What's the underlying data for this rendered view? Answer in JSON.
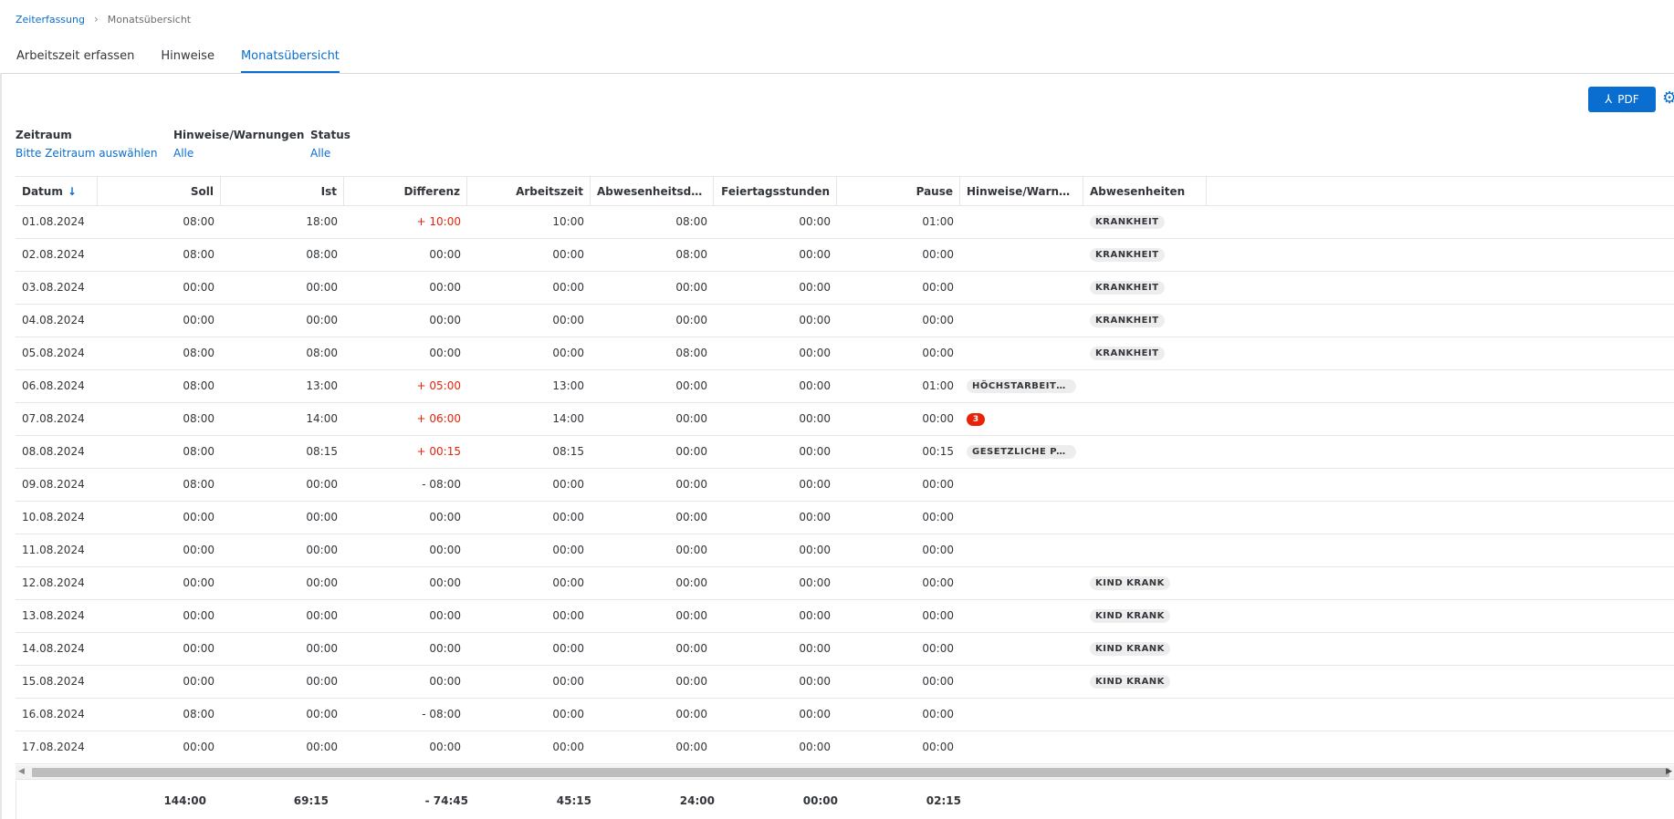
{
  "breadcrumb": {
    "link": "Zeiterfassung",
    "separator": "›",
    "current": "Monatsübersicht"
  },
  "tabs": [
    {
      "label": "Arbeitszeit erfassen"
    },
    {
      "label": "Hinweise"
    },
    {
      "label": "Monatsübersicht"
    }
  ],
  "toolbar": {
    "pdf_label": "PDF",
    "pdf_icon": "acrobat-icon",
    "settings_icon": "gear-icon"
  },
  "filters": {
    "zeitraum": {
      "label": "Zeitraum",
      "value": "Bitte Zeitraum auswählen"
    },
    "hinweise": {
      "label": "Hinweise/Warnungen",
      "value": "Alle"
    },
    "status": {
      "label": "Status",
      "value": "Alle"
    }
  },
  "table": {
    "sort_icon": "sort-descending-icon",
    "columns": [
      "Datum",
      "Soll",
      "Ist",
      "Differenz",
      "Arbeitszeit",
      "Abwesenheitsdauer",
      "Feiertagsstunden",
      "Pause",
      "Hinweise/Warnungen",
      "Abwesenheiten"
    ],
    "rows": [
      {
        "datum": "01.08.2024",
        "soll": "08:00",
        "ist": "18:00",
        "differenz": "+ 10:00",
        "arbeitszeit": "10:00",
        "abwesenheitsdauer": "08:00",
        "feiertagsstunden": "00:00",
        "pause": "01:00",
        "hinweise": "",
        "hinweise_count": "",
        "abwesenheiten": "KRANKHEIT"
      },
      {
        "datum": "02.08.2024",
        "soll": "08:00",
        "ist": "08:00",
        "differenz": "00:00",
        "arbeitszeit": "00:00",
        "abwesenheitsdauer": "08:00",
        "feiertagsstunden": "00:00",
        "pause": "00:00",
        "hinweise": "",
        "hinweise_count": "",
        "abwesenheiten": "KRANKHEIT"
      },
      {
        "datum": "03.08.2024",
        "soll": "00:00",
        "ist": "00:00",
        "differenz": "00:00",
        "arbeitszeit": "00:00",
        "abwesenheitsdauer": "00:00",
        "feiertagsstunden": "00:00",
        "pause": "00:00",
        "hinweise": "",
        "hinweise_count": "",
        "abwesenheiten": "KRANKHEIT"
      },
      {
        "datum": "04.08.2024",
        "soll": "00:00",
        "ist": "00:00",
        "differenz": "00:00",
        "arbeitszeit": "00:00",
        "abwesenheitsdauer": "00:00",
        "feiertagsstunden": "00:00",
        "pause": "00:00",
        "hinweise": "",
        "hinweise_count": "",
        "abwesenheiten": "KRANKHEIT"
      },
      {
        "datum": "05.08.2024",
        "soll": "08:00",
        "ist": "08:00",
        "differenz": "00:00",
        "arbeitszeit": "00:00",
        "abwesenheitsdauer": "08:00",
        "feiertagsstunden": "00:00",
        "pause": "00:00",
        "hinweise": "",
        "hinweise_count": "",
        "abwesenheiten": "KRANKHEIT"
      },
      {
        "datum": "06.08.2024",
        "soll": "08:00",
        "ist": "13:00",
        "differenz": "+ 05:00",
        "arbeitszeit": "13:00",
        "abwesenheitsdauer": "00:00",
        "feiertagsstunden": "00:00",
        "pause": "01:00",
        "hinweise": "HÖCHSTARBEITSZE...",
        "hinweise_count": "",
        "abwesenheiten": ""
      },
      {
        "datum": "07.08.2024",
        "soll": "08:00",
        "ist": "14:00",
        "differenz": "+ 06:00",
        "arbeitszeit": "14:00",
        "abwesenheitsdauer": "00:00",
        "feiertagsstunden": "00:00",
        "pause": "00:00",
        "hinweise": "",
        "hinweise_count": "3",
        "abwesenheiten": ""
      },
      {
        "datum": "08.08.2024",
        "soll": "08:00",
        "ist": "08:15",
        "differenz": "+ 00:15",
        "arbeitszeit": "08:15",
        "abwesenheitsdauer": "00:00",
        "feiertagsstunden": "00:00",
        "pause": "00:15",
        "hinweise": "GESETZLICHE PAUS...",
        "hinweise_count": "",
        "abwesenheiten": ""
      },
      {
        "datum": "09.08.2024",
        "soll": "08:00",
        "ist": "00:00",
        "differenz": "- 08:00",
        "arbeitszeit": "00:00",
        "abwesenheitsdauer": "00:00",
        "feiertagsstunden": "00:00",
        "pause": "00:00",
        "hinweise": "",
        "hinweise_count": "",
        "abwesenheiten": ""
      },
      {
        "datum": "10.08.2024",
        "soll": "00:00",
        "ist": "00:00",
        "differenz": "00:00",
        "arbeitszeit": "00:00",
        "abwesenheitsdauer": "00:00",
        "feiertagsstunden": "00:00",
        "pause": "00:00",
        "hinweise": "",
        "hinweise_count": "",
        "abwesenheiten": ""
      },
      {
        "datum": "11.08.2024",
        "soll": "00:00",
        "ist": "00:00",
        "differenz": "00:00",
        "arbeitszeit": "00:00",
        "abwesenheitsdauer": "00:00",
        "feiertagsstunden": "00:00",
        "pause": "00:00",
        "hinweise": "",
        "hinweise_count": "",
        "abwesenheiten": ""
      },
      {
        "datum": "12.08.2024",
        "soll": "00:00",
        "ist": "00:00",
        "differenz": "00:00",
        "arbeitszeit": "00:00",
        "abwesenheitsdauer": "00:00",
        "feiertagsstunden": "00:00",
        "pause": "00:00",
        "hinweise": "",
        "hinweise_count": "",
        "abwesenheiten": "KIND KRANK"
      },
      {
        "datum": "13.08.2024",
        "soll": "00:00",
        "ist": "00:00",
        "differenz": "00:00",
        "arbeitszeit": "00:00",
        "abwesenheitsdauer": "00:00",
        "feiertagsstunden": "00:00",
        "pause": "00:00",
        "hinweise": "",
        "hinweise_count": "",
        "abwesenheiten": "KIND KRANK"
      },
      {
        "datum": "14.08.2024",
        "soll": "00:00",
        "ist": "00:00",
        "differenz": "00:00",
        "arbeitszeit": "00:00",
        "abwesenheitsdauer": "00:00",
        "feiertagsstunden": "00:00",
        "pause": "00:00",
        "hinweise": "",
        "hinweise_count": "",
        "abwesenheiten": "KIND KRANK"
      },
      {
        "datum": "15.08.2024",
        "soll": "00:00",
        "ist": "00:00",
        "differenz": "00:00",
        "arbeitszeit": "00:00",
        "abwesenheitsdauer": "00:00",
        "feiertagsstunden": "00:00",
        "pause": "00:00",
        "hinweise": "",
        "hinweise_count": "",
        "abwesenheiten": "KIND KRANK"
      },
      {
        "datum": "16.08.2024",
        "soll": "08:00",
        "ist": "00:00",
        "differenz": "- 08:00",
        "arbeitszeit": "00:00",
        "abwesenheitsdauer": "00:00",
        "feiertagsstunden": "00:00",
        "pause": "00:00",
        "hinweise": "",
        "hinweise_count": "",
        "abwesenheiten": ""
      },
      {
        "datum": "17.08.2024",
        "soll": "00:00",
        "ist": "00:00",
        "differenz": "00:00",
        "arbeitszeit": "00:00",
        "abwesenheitsdauer": "00:00",
        "feiertagsstunden": "00:00",
        "pause": "00:00",
        "hinweise": "",
        "hinweise_count": "",
        "abwesenheiten": ""
      }
    ],
    "totals": {
      "soll": "144:00",
      "ist": "69:15",
      "differenz": "- 74:45",
      "arbeitszeit": "45:15",
      "abwesenheitsdauer": "24:00",
      "feiertagsstunden": "00:00",
      "pause": "02:15"
    }
  },
  "colors": {
    "accent": "#0a6ed1",
    "positive_diff": "#e9230a",
    "badge_bg": "#ededed",
    "count_badge": "#e9230a"
  }
}
